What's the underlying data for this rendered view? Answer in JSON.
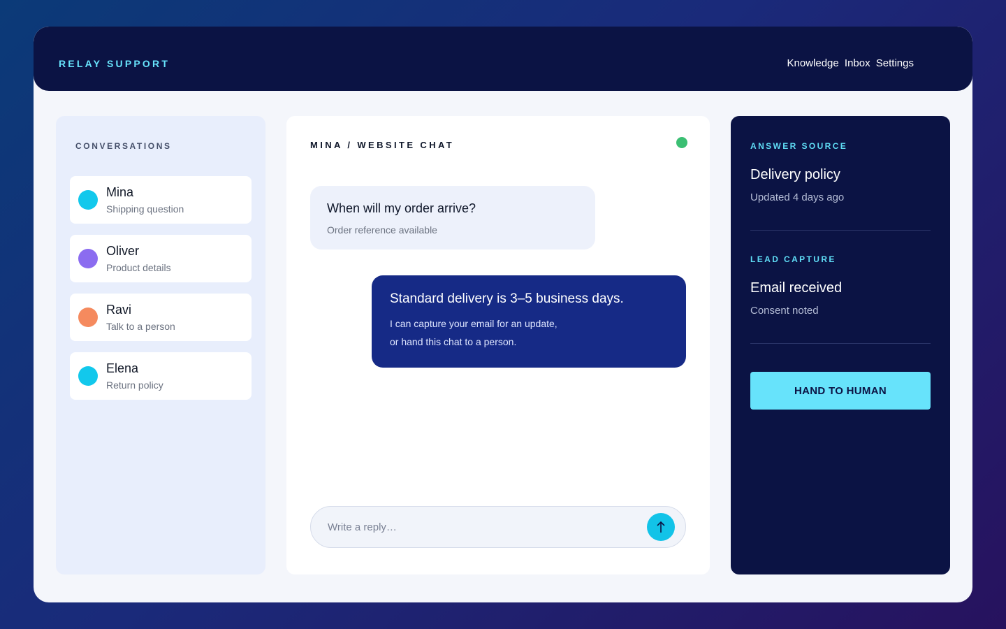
{
  "header": {
    "brand": "RELAY SUPPORT",
    "nav": [
      "Knowledge",
      "Inbox",
      "Settings"
    ]
  },
  "sidebar": {
    "title": "CONVERSATIONS",
    "items": [
      {
        "name": "Mina",
        "subtitle": "Shipping question",
        "color": "#12c8ec"
      },
      {
        "name": "Oliver",
        "subtitle": "Product details",
        "color": "#8b6cf0"
      },
      {
        "name": "Ravi",
        "subtitle": "Talk to a person",
        "color": "#f58a5e"
      },
      {
        "name": "Elena",
        "subtitle": "Return policy",
        "color": "#12c8ec"
      }
    ]
  },
  "chat": {
    "title": "MINA / WEBSITE CHAT",
    "status_color": "#3bbf73",
    "incoming": {
      "text": "When will my order arrive?",
      "meta": "Order reference available"
    },
    "outgoing": {
      "text": "Standard delivery is 3–5 business days.",
      "line2": "I can capture your email for an update,",
      "line3": "or hand this chat to a person."
    },
    "composer": {
      "placeholder": "Write a reply…",
      "send_icon": "arrow-up-icon"
    }
  },
  "info": {
    "answer_source": {
      "label": "ANSWER SOURCE",
      "title": "Delivery policy",
      "meta": "Updated 4 days ago"
    },
    "lead_capture": {
      "label": "LEAD CAPTURE",
      "title": "Email received",
      "meta": "Consent noted"
    },
    "button": "HAND TO HUMAN"
  },
  "colors": {
    "accent": "#67e3fb",
    "navy": "#0b1344",
    "bubble_out": "#162a86"
  }
}
